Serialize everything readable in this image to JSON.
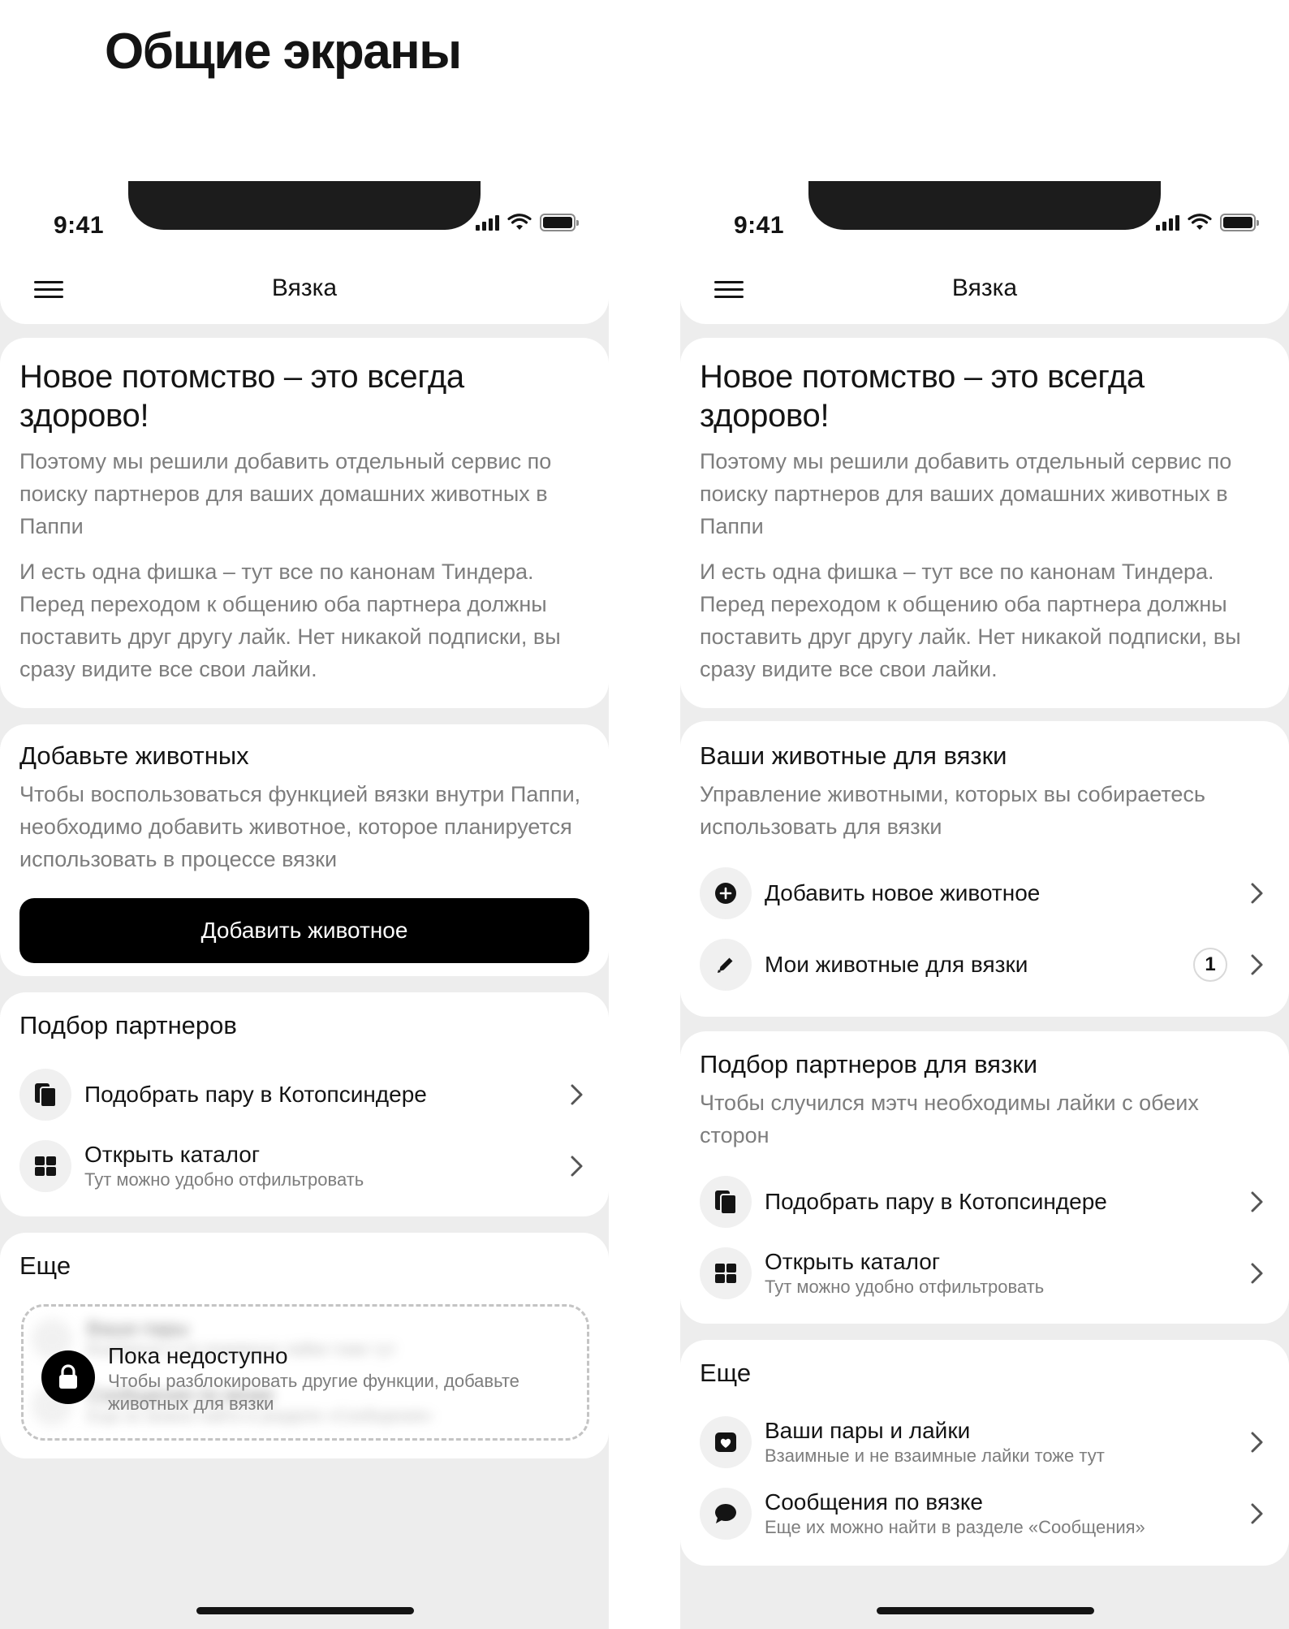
{
  "page_title": "Общие экраны",
  "screens": [
    {
      "status": {
        "time": "9:41"
      },
      "nav": {
        "title": "Вязка"
      },
      "intro": {
        "title": "Новое потомство – это всегда здорово!",
        "p1": "Поэтому мы решили добавить отдельный сервис по поиску партнеров для ваших домашних животных в Паппи",
        "p2": "И есть одна фишка – тут все по канонам Тиндера. Перед переходом к общению оба партнера должны поставить друг другу лайк. Нет никакой подписки, вы сразу видите все свои лайки."
      },
      "add_animals": {
        "title": "Добавьте животных",
        "subtitle": "Чтобы воспользоваться функцией вязки внутри Паппи, необходимо добавить животное, которое планируется использовать в процессе вязки",
        "button_label": "Добавить животное"
      },
      "partners": {
        "title": "Подбор партнеров",
        "items": [
          {
            "label": "Подобрать пару в Котопсиндере",
            "icon": "cards-icon"
          },
          {
            "label": "Открыть каталог",
            "sub": "Тут можно удобно отфильтровать",
            "icon": "grid-icon"
          }
        ]
      },
      "more": {
        "title": "Еще",
        "blurred_items": [
          {
            "label": "Ваши пары",
            "sub": "Взаимные и не взаимные лайки тоже тут"
          },
          {
            "label": "Сообщения по вязке",
            "sub": "Еще их можно найти в разделе «Сообщения»"
          }
        ],
        "locked_title": "Пока недоступно",
        "locked_sub": "Чтобы разблокировать другие функции, добавьте животных для вязки"
      }
    },
    {
      "status": {
        "time": "9:41"
      },
      "nav": {
        "title": "Вязка"
      },
      "intro": {
        "title": "Новое потомство – это всегда здорово!",
        "p1": "Поэтому мы решили добавить отдельный сервис по поиску партнеров для ваших домашних животных в Паппи",
        "p2": "И есть одна фишка – тут все по канонам Тиндера. Перед переходом к общению оба партнера должны поставить друг другу лайк. Нет никакой подписки, вы сразу видите все свои лайки."
      },
      "my_animals": {
        "title": "Ваши животные для вязки",
        "subtitle": "Управление животными, которых вы собираетесь использовать для вязки",
        "items": [
          {
            "label": "Добавить новое животное",
            "icon": "plus-circle-icon"
          },
          {
            "label": "Мои животные для вязки",
            "icon": "pencil-icon",
            "badge": "1"
          }
        ]
      },
      "partners": {
        "title": "Подбор партнеров для вязки",
        "subtitle": "Чтобы случился мэтч необходимы лайки с обеих сторон",
        "items": [
          {
            "label": "Подобрать пару в Котопсиндере",
            "icon": "cards-icon"
          },
          {
            "label": "Открыть каталог",
            "sub": "Тут можно удобно отфильтровать",
            "icon": "grid-icon"
          }
        ]
      },
      "more": {
        "title": "Еще",
        "items": [
          {
            "label": "Ваши пары и лайки",
            "sub": "Взаимные и не взаимные лайки тоже тут",
            "icon": "heart-box-icon"
          },
          {
            "label": "Сообщения по вязке",
            "sub": "Еще их можно найти в разделе «Сообщения»",
            "icon": "chat-bubble-icon"
          }
        ]
      }
    }
  ]
}
